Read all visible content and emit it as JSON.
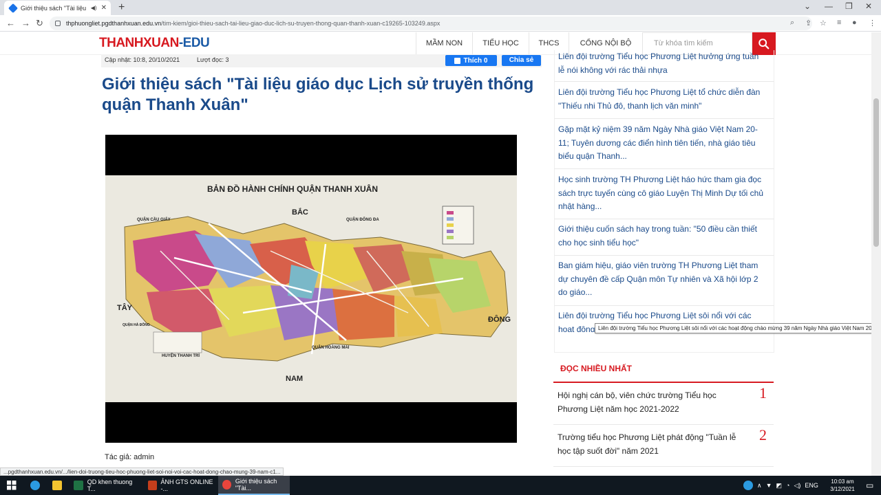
{
  "browser": {
    "tab_title": "Giới thiệu sách \"Tài liệu giáo",
    "url_host": "thphuongliet.pgdthanhxuan.edu.vn",
    "url_path": "/tim-kiem/gioi-thieu-sach-tai-lieu-giao-duc-lich-su-truyen-thong-quan-thanh-xuan-c19265-103249.aspx",
    "status_url": "...pgdthanhxuan.edu.vn/.../lien-doi-truong-tieu-hoc-phuong-liet-soi-noi-voi-cac-hoat-dong-chao-mung-39-nam-c1..."
  },
  "header": {
    "logo_main": "THANHXUAN",
    "logo_suffix": "-EDU",
    "menu": [
      "MẦM NON",
      "TIỂU HỌC",
      "THCS",
      "CỔNG NỘI BỘ"
    ],
    "search_placeholder": "Từ khóa tìm kiếm"
  },
  "article": {
    "updated": "Cập nhật: 10:8, 20/10/2021",
    "views": "Lượt đọc: 3",
    "like_label": "Thích 0",
    "share_label": "Chia sẻ",
    "title": "Giới thiệu sách \"Tài liệu giáo dục Lịch sử truyền thống quận Thanh Xuân\"",
    "author": "Tác giả: admin",
    "map": {
      "title": "BẢN ĐỒ HÀNH CHÍNH QUẬN THANH XUÂN",
      "north": "BẮC",
      "south": "NAM",
      "west": "TÂY",
      "east": "ĐÔNG",
      "cau_giay": "QUẬN CẦU GIẤY",
      "dong_da": "QUẬN ĐỐNG ĐA",
      "hoang_mai": "QUẬN HOÀNG MAI",
      "thanh_tri": "HUYỆN THANH TRÌ",
      "ha_dong": "QUẬN HÀ ĐÔNG"
    }
  },
  "sidebar": {
    "items": [
      "Liên đội trường Tiểu học Phương Liệt hưởng ứng tuần lễ nói không với rác thải nhựa",
      "Liên đội trường Tiểu học Phương Liệt tổ chức diễn đàn \"Thiếu nhi Thủ đô, thanh lịch văn minh\"",
      "Gặp mặt kỷ niệm 39 năm Ngày Nhà giáo Việt Nam 20-11; Tuyên dương các điển hình tiên tiến, nhà giáo tiêu biểu quận Thanh...",
      "Học sinh trường TH Phương Liệt háo hức tham gia đọc sách trực tuyến cùng cô giáo Luyện Thị Minh Dự tối chủ nhật hàng...",
      "Giới thiệu cuốn sách hay trong tuần: \"50 điều cần thiết cho học sinh tiểu học\"",
      "Ban giám hiệu, giáo viên trường TH Phương Liệt tham dự chuyên đề cấp Quận môn Tự nhiên và Xã hội lớp 2 do giáo...",
      "Liên đội trường Tiểu học Phương Liệt sôi nổi với các hoạt động chào"
    ],
    "tooltip": "Liên đội trường Tiểu học Phương Liệt sôi nổi với các hoạt động chào mừng 39 năm Ngày Nhà giáo Việt Nam 20/11",
    "most_read_title": "ĐỌC NHIỀU NHẤT",
    "most_read": [
      {
        "title": "Hội nghị cán bộ, viên chức trường Tiểu học Phương Liệt năm học 2021-2022",
        "rank": "1"
      },
      {
        "title": "Trường tiểu học Phương Liệt phát động \"Tuần lễ học tập suốt đời\" năm 2021",
        "rank": "2"
      }
    ]
  },
  "taskbar": {
    "apps": [
      "QD khen thuong T...",
      "ẢNH GTS ONLINE -...",
      "Giới thiệu sách \"Tài..."
    ],
    "lang": "ENG",
    "time": "10:03 am",
    "date": "3/12/2021"
  },
  "colors": {
    "brand_red": "#d71920",
    "title_blue": "#1a4a8a",
    "facebook": "#1877f2"
  }
}
